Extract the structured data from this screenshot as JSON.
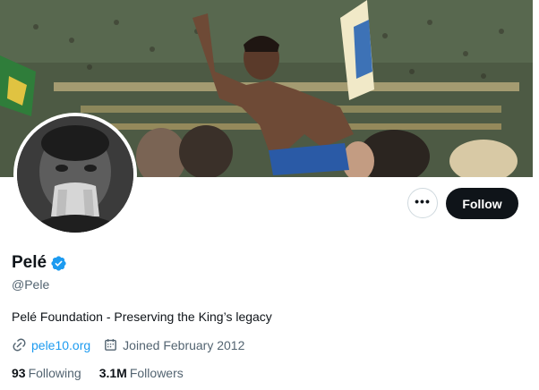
{
  "header": {
    "more_icon": "ellipsis-icon",
    "follow_label": "Follow"
  },
  "profile": {
    "name": "Pelé",
    "verified_icon": "verified-badge-icon",
    "handle": "@Pele",
    "bio": "Pelé Foundation - Preserving the King’s legacy",
    "website": "pele10.org",
    "joined": "Joined February 2012",
    "following_count": "93",
    "following_label": "Following",
    "followers_count": "3.1M",
    "followers_label": "Followers"
  },
  "colors": {
    "accent": "#1d9bf0",
    "text": "#0f1419",
    "muted": "#536471",
    "button": "#0f1419"
  }
}
